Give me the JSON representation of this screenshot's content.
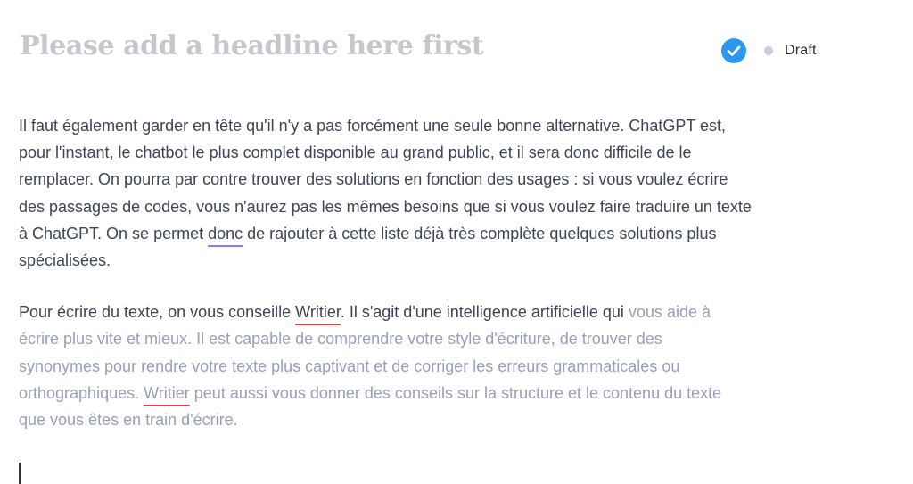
{
  "header": {
    "headline_placeholder": "Please add a headline here first",
    "status": {
      "check_icon": "check-circle-icon",
      "check_color": "#2d97f0",
      "draft_label": "Draft"
    }
  },
  "editor": {
    "paragraph1": {
      "line1": "Il faut également garder en tête qu'il n'y a pas forcément une seule bonne alternative. ChatGPT est,",
      "line2": "pour l'instant, le chatbot le plus complet disponible au grand public, et il sera donc difficile de le",
      "line3": "remplacer. On pourra par contre trouver des solutions en fonction des usages : si vous voulez écrire",
      "line4": "des passages de codes, vous n'aurez pas les mêmes besoins que si vous voulez faire traduire un texte",
      "line5_a": "à ChatGPT. On se permet ",
      "line5_word": "donc",
      "line5_b": " de rajouter à cette liste déjà très complète quelques solutions plus",
      "line6": "spécialisées."
    },
    "paragraph2": {
      "line1_a": "Pour écrire du texte, on vous conseille ",
      "line1_word": "Writier",
      "line1_b": ". Il s'agit d'une intelligence artificielle qui ",
      "line1_c": "vous aide à",
      "line2": "écrire plus vite et mieux. Il est capable de comprendre votre style d'écriture, de trouver des",
      "line3": "synonymes pour rendre votre texte plus captivant et de corriger les erreurs grammaticales ou",
      "line4_a": "orthographiques. ",
      "line4_word": "Writier",
      "line4_b": " peut aussi vous donner des conseils sur la structure et le contenu du texte",
      "line5": "que vous êtes en train d'écrire."
    }
  }
}
